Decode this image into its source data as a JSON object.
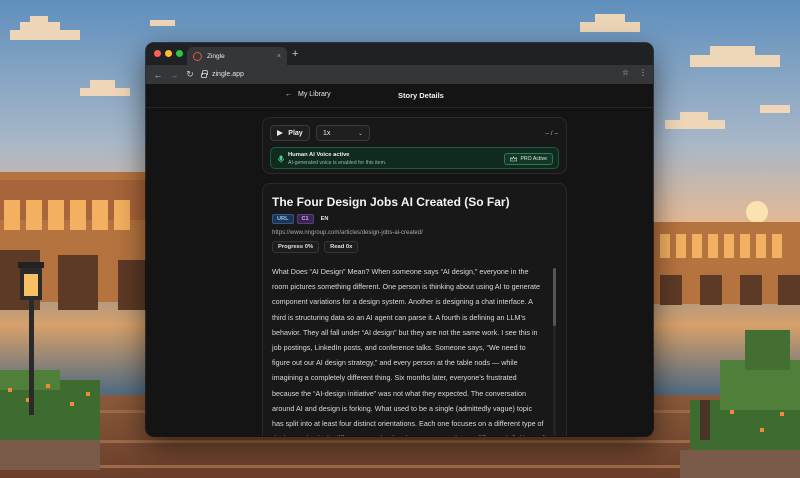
{
  "browser": {
    "tab_title": "Zingle",
    "tab_close": "×",
    "new_tab": "+",
    "nav_back": "←",
    "nav_forward": "→",
    "nav_reload": "↻",
    "url": "zingle.app",
    "bookmark": "☆",
    "menu": "⋮"
  },
  "app": {
    "back_label": "My Library",
    "back_arrow": "←",
    "page_title": "Story Details"
  },
  "player": {
    "play_label": "Play",
    "speed": "1x",
    "time_display": "– / –",
    "voice_title": "Human AI Voice active",
    "voice_subtitle": "AI-generated voice is enabled for this item.",
    "pro_badge": "PRO Active"
  },
  "story": {
    "title": "The Four Design Jobs AI Created (So Far)",
    "tags": [
      "URL",
      "C1",
      "EN"
    ],
    "source_url": "https://www.nngroup.com/articles/design-jobs-ai-created/",
    "progress": "Progress 0%",
    "read_count": "Read 0x",
    "body": "What Does “AI Design” Mean? When someone says “AI design,” everyone in the room pictures something different. One person is thinking about using AI to generate component variations for a design system. Another is designing a chat interface. A third is structuring data so an AI agent can parse it. A fourth is defining an LLM’s behavior. They all fall under “AI design” but they are not the same work. I see this in job postings, LinkedIn posts, and conference talks. Someone says, “We need to figure out our AI design strategy,” and every person at the table nods — while imagining a completely different thing. Six months later, everyone’s frustrated because the “AI-design initiative” was not what they expected.  The conversation around AI and design is forking. What used to be a single (admittedly vague) topic has split into at least four distinct orientations. Each one focuses on a different type of design work, sits in different organizational structures, and uses different definitions of what “good” looks like."
  },
  "colors": {
    "accent_green": "#28c840",
    "banner_bg": "#102a1f",
    "tag_url": "#8cc0ff",
    "tag_level": "#d3a8ff"
  },
  "icons": [
    "favicon-icon",
    "lock-icon",
    "play-icon",
    "chevron-down-icon",
    "mic-icon",
    "crown-icon",
    "back-arrow-icon",
    "star-icon",
    "kebab-menu-icon"
  ]
}
